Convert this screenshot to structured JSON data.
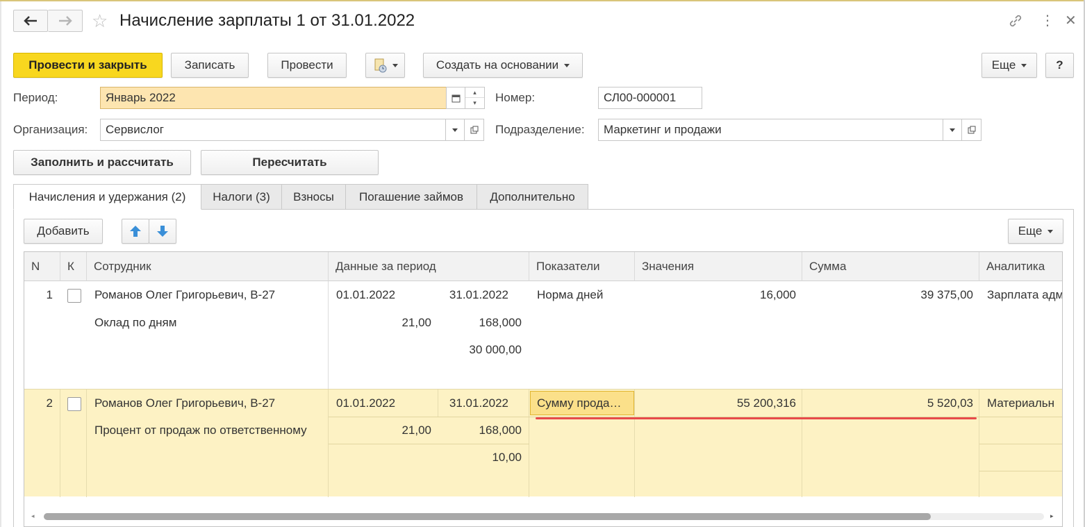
{
  "window": {
    "title": "Начисление зарплаты 1 от 31.01.2022"
  },
  "toolbar": {
    "post_close": "Провести и закрыть",
    "save": "Записать",
    "post": "Провести",
    "create_based": "Создать на основании",
    "more": "Еще",
    "help": "?"
  },
  "form": {
    "period_label": "Период:",
    "period_value": "Январь 2022",
    "number_label": "Номер:",
    "number_value": "СЛ00-000001",
    "org_label": "Организация:",
    "org_value": "Сервислог",
    "dept_label": "Подразделение:",
    "dept_value": "Маркетинг и продажи",
    "fill_calc": "Заполнить и рассчитать",
    "recalc": "Пересчитать"
  },
  "tabs": [
    {
      "label": "Начисления и удержания (2)",
      "active": true
    },
    {
      "label": "Налоги (3)"
    },
    {
      "label": "Взносы"
    },
    {
      "label": "Погашение займов"
    },
    {
      "label": "Дополнительно"
    }
  ],
  "table_toolbar": {
    "add": "Добавить",
    "more": "Еще"
  },
  "table": {
    "columns": [
      "N",
      "К",
      "Сотрудник",
      "Данные за период",
      "Показатели",
      "Значения",
      "Сумма",
      "Аналитика"
    ],
    "rows": [
      {
        "n": "1",
        "employee": "Романов Олег Григорьевич, В-27",
        "accrual": "Оклад по дням",
        "date_from": "01.01.2022",
        "date_to": "31.01.2022",
        "val_a": "21,00",
        "val_b": "168,000",
        "val_c": "30 000,00",
        "indicator": "Норма дней",
        "value": "16,000",
        "sum": "39 375,00",
        "analytics": "Зарплата адм"
      },
      {
        "n": "2",
        "employee": "Романов Олег Григорьевич, В-27",
        "accrual": "Процент от продаж по ответственному",
        "date_from": "01.01.2022",
        "date_to": "31.01.2022",
        "val_a": "21,00",
        "val_b": "168,000",
        "val_c": "10,00",
        "indicator": "Сумму прода…",
        "value": "55 200,316",
        "sum": "5 520,03",
        "analytics": "Материальн"
      }
    ]
  },
  "colors": {
    "primary_button": "#f8d71f",
    "period_field": "#fde5b0",
    "selected_row": "#fdf2c4",
    "active_cell": "#fbe08a",
    "underline": "#e84a4a"
  }
}
